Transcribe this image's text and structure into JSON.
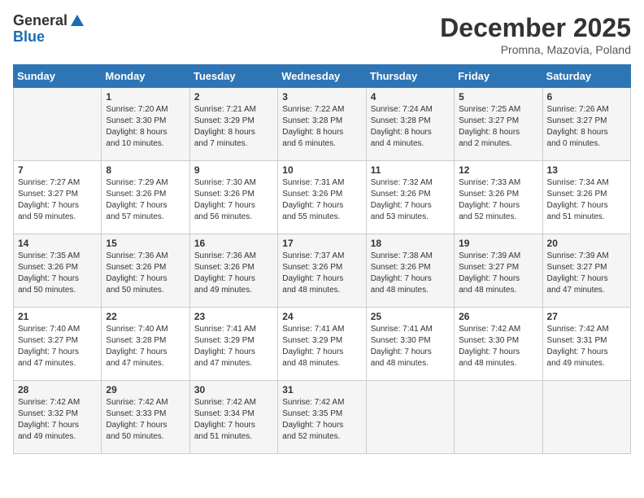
{
  "logo": {
    "general": "General",
    "blue": "Blue"
  },
  "header": {
    "month": "December 2025",
    "location": "Promna, Mazovia, Poland"
  },
  "weekdays": [
    "Sunday",
    "Monday",
    "Tuesday",
    "Wednesday",
    "Thursday",
    "Friday",
    "Saturday"
  ],
  "weeks": [
    [
      {
        "day": "",
        "info": ""
      },
      {
        "day": "1",
        "info": "Sunrise: 7:20 AM\nSunset: 3:30 PM\nDaylight: 8 hours\nand 10 minutes."
      },
      {
        "day": "2",
        "info": "Sunrise: 7:21 AM\nSunset: 3:29 PM\nDaylight: 8 hours\nand 7 minutes."
      },
      {
        "day": "3",
        "info": "Sunrise: 7:22 AM\nSunset: 3:28 PM\nDaylight: 8 hours\nand 6 minutes."
      },
      {
        "day": "4",
        "info": "Sunrise: 7:24 AM\nSunset: 3:28 PM\nDaylight: 8 hours\nand 4 minutes."
      },
      {
        "day": "5",
        "info": "Sunrise: 7:25 AM\nSunset: 3:27 PM\nDaylight: 8 hours\nand 2 minutes."
      },
      {
        "day": "6",
        "info": "Sunrise: 7:26 AM\nSunset: 3:27 PM\nDaylight: 8 hours\nand 0 minutes."
      }
    ],
    [
      {
        "day": "7",
        "info": "Sunrise: 7:27 AM\nSunset: 3:27 PM\nDaylight: 7 hours\nand 59 minutes."
      },
      {
        "day": "8",
        "info": "Sunrise: 7:29 AM\nSunset: 3:26 PM\nDaylight: 7 hours\nand 57 minutes."
      },
      {
        "day": "9",
        "info": "Sunrise: 7:30 AM\nSunset: 3:26 PM\nDaylight: 7 hours\nand 56 minutes."
      },
      {
        "day": "10",
        "info": "Sunrise: 7:31 AM\nSunset: 3:26 PM\nDaylight: 7 hours\nand 55 minutes."
      },
      {
        "day": "11",
        "info": "Sunrise: 7:32 AM\nSunset: 3:26 PM\nDaylight: 7 hours\nand 53 minutes."
      },
      {
        "day": "12",
        "info": "Sunrise: 7:33 AM\nSunset: 3:26 PM\nDaylight: 7 hours\nand 52 minutes."
      },
      {
        "day": "13",
        "info": "Sunrise: 7:34 AM\nSunset: 3:26 PM\nDaylight: 7 hours\nand 51 minutes."
      }
    ],
    [
      {
        "day": "14",
        "info": "Sunrise: 7:35 AM\nSunset: 3:26 PM\nDaylight: 7 hours\nand 50 minutes."
      },
      {
        "day": "15",
        "info": "Sunrise: 7:36 AM\nSunset: 3:26 PM\nDaylight: 7 hours\nand 50 minutes."
      },
      {
        "day": "16",
        "info": "Sunrise: 7:36 AM\nSunset: 3:26 PM\nDaylight: 7 hours\nand 49 minutes."
      },
      {
        "day": "17",
        "info": "Sunrise: 7:37 AM\nSunset: 3:26 PM\nDaylight: 7 hours\nand 48 minutes."
      },
      {
        "day": "18",
        "info": "Sunrise: 7:38 AM\nSunset: 3:26 PM\nDaylight: 7 hours\nand 48 minutes."
      },
      {
        "day": "19",
        "info": "Sunrise: 7:39 AM\nSunset: 3:27 PM\nDaylight: 7 hours\nand 48 minutes."
      },
      {
        "day": "20",
        "info": "Sunrise: 7:39 AM\nSunset: 3:27 PM\nDaylight: 7 hours\nand 47 minutes."
      }
    ],
    [
      {
        "day": "21",
        "info": "Sunrise: 7:40 AM\nSunset: 3:27 PM\nDaylight: 7 hours\nand 47 minutes."
      },
      {
        "day": "22",
        "info": "Sunrise: 7:40 AM\nSunset: 3:28 PM\nDaylight: 7 hours\nand 47 minutes."
      },
      {
        "day": "23",
        "info": "Sunrise: 7:41 AM\nSunset: 3:29 PM\nDaylight: 7 hours\nand 47 minutes."
      },
      {
        "day": "24",
        "info": "Sunrise: 7:41 AM\nSunset: 3:29 PM\nDaylight: 7 hours\nand 48 minutes."
      },
      {
        "day": "25",
        "info": "Sunrise: 7:41 AM\nSunset: 3:30 PM\nDaylight: 7 hours\nand 48 minutes."
      },
      {
        "day": "26",
        "info": "Sunrise: 7:42 AM\nSunset: 3:30 PM\nDaylight: 7 hours\nand 48 minutes."
      },
      {
        "day": "27",
        "info": "Sunrise: 7:42 AM\nSunset: 3:31 PM\nDaylight: 7 hours\nand 49 minutes."
      }
    ],
    [
      {
        "day": "28",
        "info": "Sunrise: 7:42 AM\nSunset: 3:32 PM\nDaylight: 7 hours\nand 49 minutes."
      },
      {
        "day": "29",
        "info": "Sunrise: 7:42 AM\nSunset: 3:33 PM\nDaylight: 7 hours\nand 50 minutes."
      },
      {
        "day": "30",
        "info": "Sunrise: 7:42 AM\nSunset: 3:34 PM\nDaylight: 7 hours\nand 51 minutes."
      },
      {
        "day": "31",
        "info": "Sunrise: 7:42 AM\nSunset: 3:35 PM\nDaylight: 7 hours\nand 52 minutes."
      },
      {
        "day": "",
        "info": ""
      },
      {
        "day": "",
        "info": ""
      },
      {
        "day": "",
        "info": ""
      }
    ]
  ]
}
